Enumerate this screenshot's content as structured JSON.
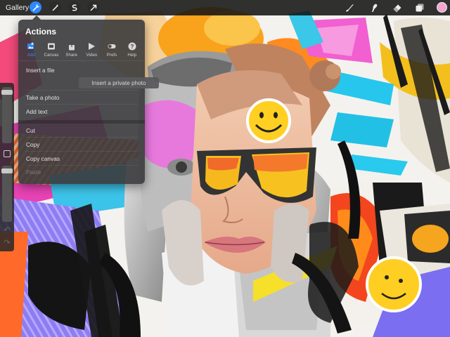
{
  "toolbar": {
    "gallery_label": "Gallery",
    "left_icons": [
      "wrench-icon",
      "magic-wand-icon",
      "selection-s-icon",
      "transform-arrow-icon"
    ],
    "right_icons": [
      "brush-icon",
      "smudge-icon",
      "eraser-icon",
      "layers-icon"
    ],
    "active_color": "#f4a6cf"
  },
  "actions_panel": {
    "title": "Actions",
    "tabs": [
      {
        "label": "Add",
        "icon": "add-image-icon",
        "active": true
      },
      {
        "label": "Canvas",
        "icon": "canvas-icon",
        "active": false
      },
      {
        "label": "Share",
        "icon": "share-icon",
        "active": false
      },
      {
        "label": "Video",
        "icon": "play-icon",
        "active": false
      },
      {
        "label": "Prefs",
        "icon": "toggle-icon",
        "active": false
      },
      {
        "label": "Help",
        "icon": "help-icon",
        "active": false
      }
    ],
    "items": {
      "insert_file": "Insert a file",
      "insert_private_photo": "Insert a private photo",
      "take_photo": "Take a photo",
      "add_text": "Add text",
      "cut": "Cut",
      "copy": "Copy",
      "copy_canvas": "Copy canvas",
      "paste": "Paste"
    }
  },
  "sidebar": {
    "brush_size_level": 0.05,
    "opacity_level": 0.05
  },
  "colors": {
    "accent_blue": "#2f88ff",
    "panel_bg": "#3a3a3c"
  }
}
